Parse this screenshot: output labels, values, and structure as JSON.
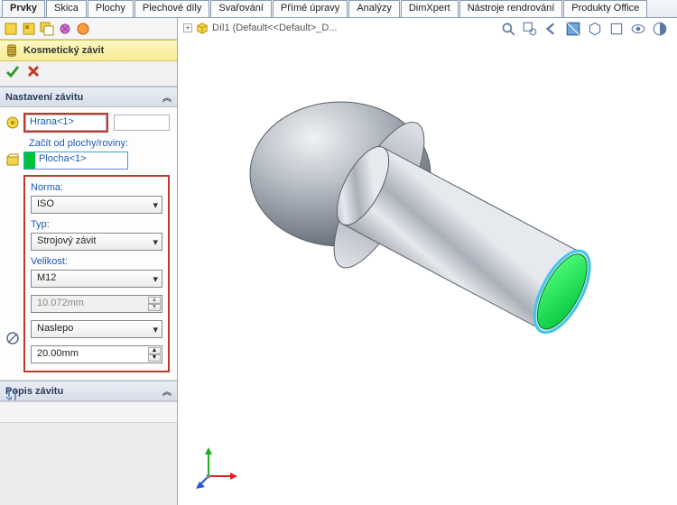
{
  "tabs": [
    "Prvky",
    "Skica",
    "Plochy",
    "Plechové díly",
    "Svařování",
    "Přímé úpravy",
    "Analýzy",
    "DimXpert",
    "Nástroje rendrování",
    "Produkty Office"
  ],
  "active_tab_index": 0,
  "feature_manager": {
    "title": "Kosmetický závit",
    "ok_icon": "check-icon",
    "cancel_icon": "x-icon"
  },
  "section_settings": {
    "title": "Nastavení závitu",
    "edge_value": "Hrana<1>",
    "start_label": "Začít od plochy/roviny:",
    "face_value": "Plocha<1>",
    "norma_label": "Norma:",
    "norma_value": "ISO",
    "typ_label": "Typ:",
    "typ_value": "Strojový závit",
    "velikost_label": "Velikost:",
    "velikost_value": "M12",
    "diameter_value": "10.072mm",
    "end_cond_value": "Naslepo",
    "depth_value": "20.00mm"
  },
  "section_desc": {
    "title": "Popis závitu"
  },
  "breadcrumb": {
    "part_name": "Díl1  (Default<<Default>_D..."
  },
  "colors": {
    "highlight_red": "#c0392b",
    "highlight_blue": "#3aa0d8",
    "face_green": "#00e03c"
  },
  "viewport_tools": [
    "zoom-fit-icon",
    "zoom-area-icon",
    "rotate-icon",
    "view-cube-icon",
    "section-icon",
    "perspective-icon",
    "shaded-icon",
    "hidden-lines-icon"
  ],
  "axis_triad": {
    "x": "red",
    "y": "green",
    "z": "blue"
  }
}
